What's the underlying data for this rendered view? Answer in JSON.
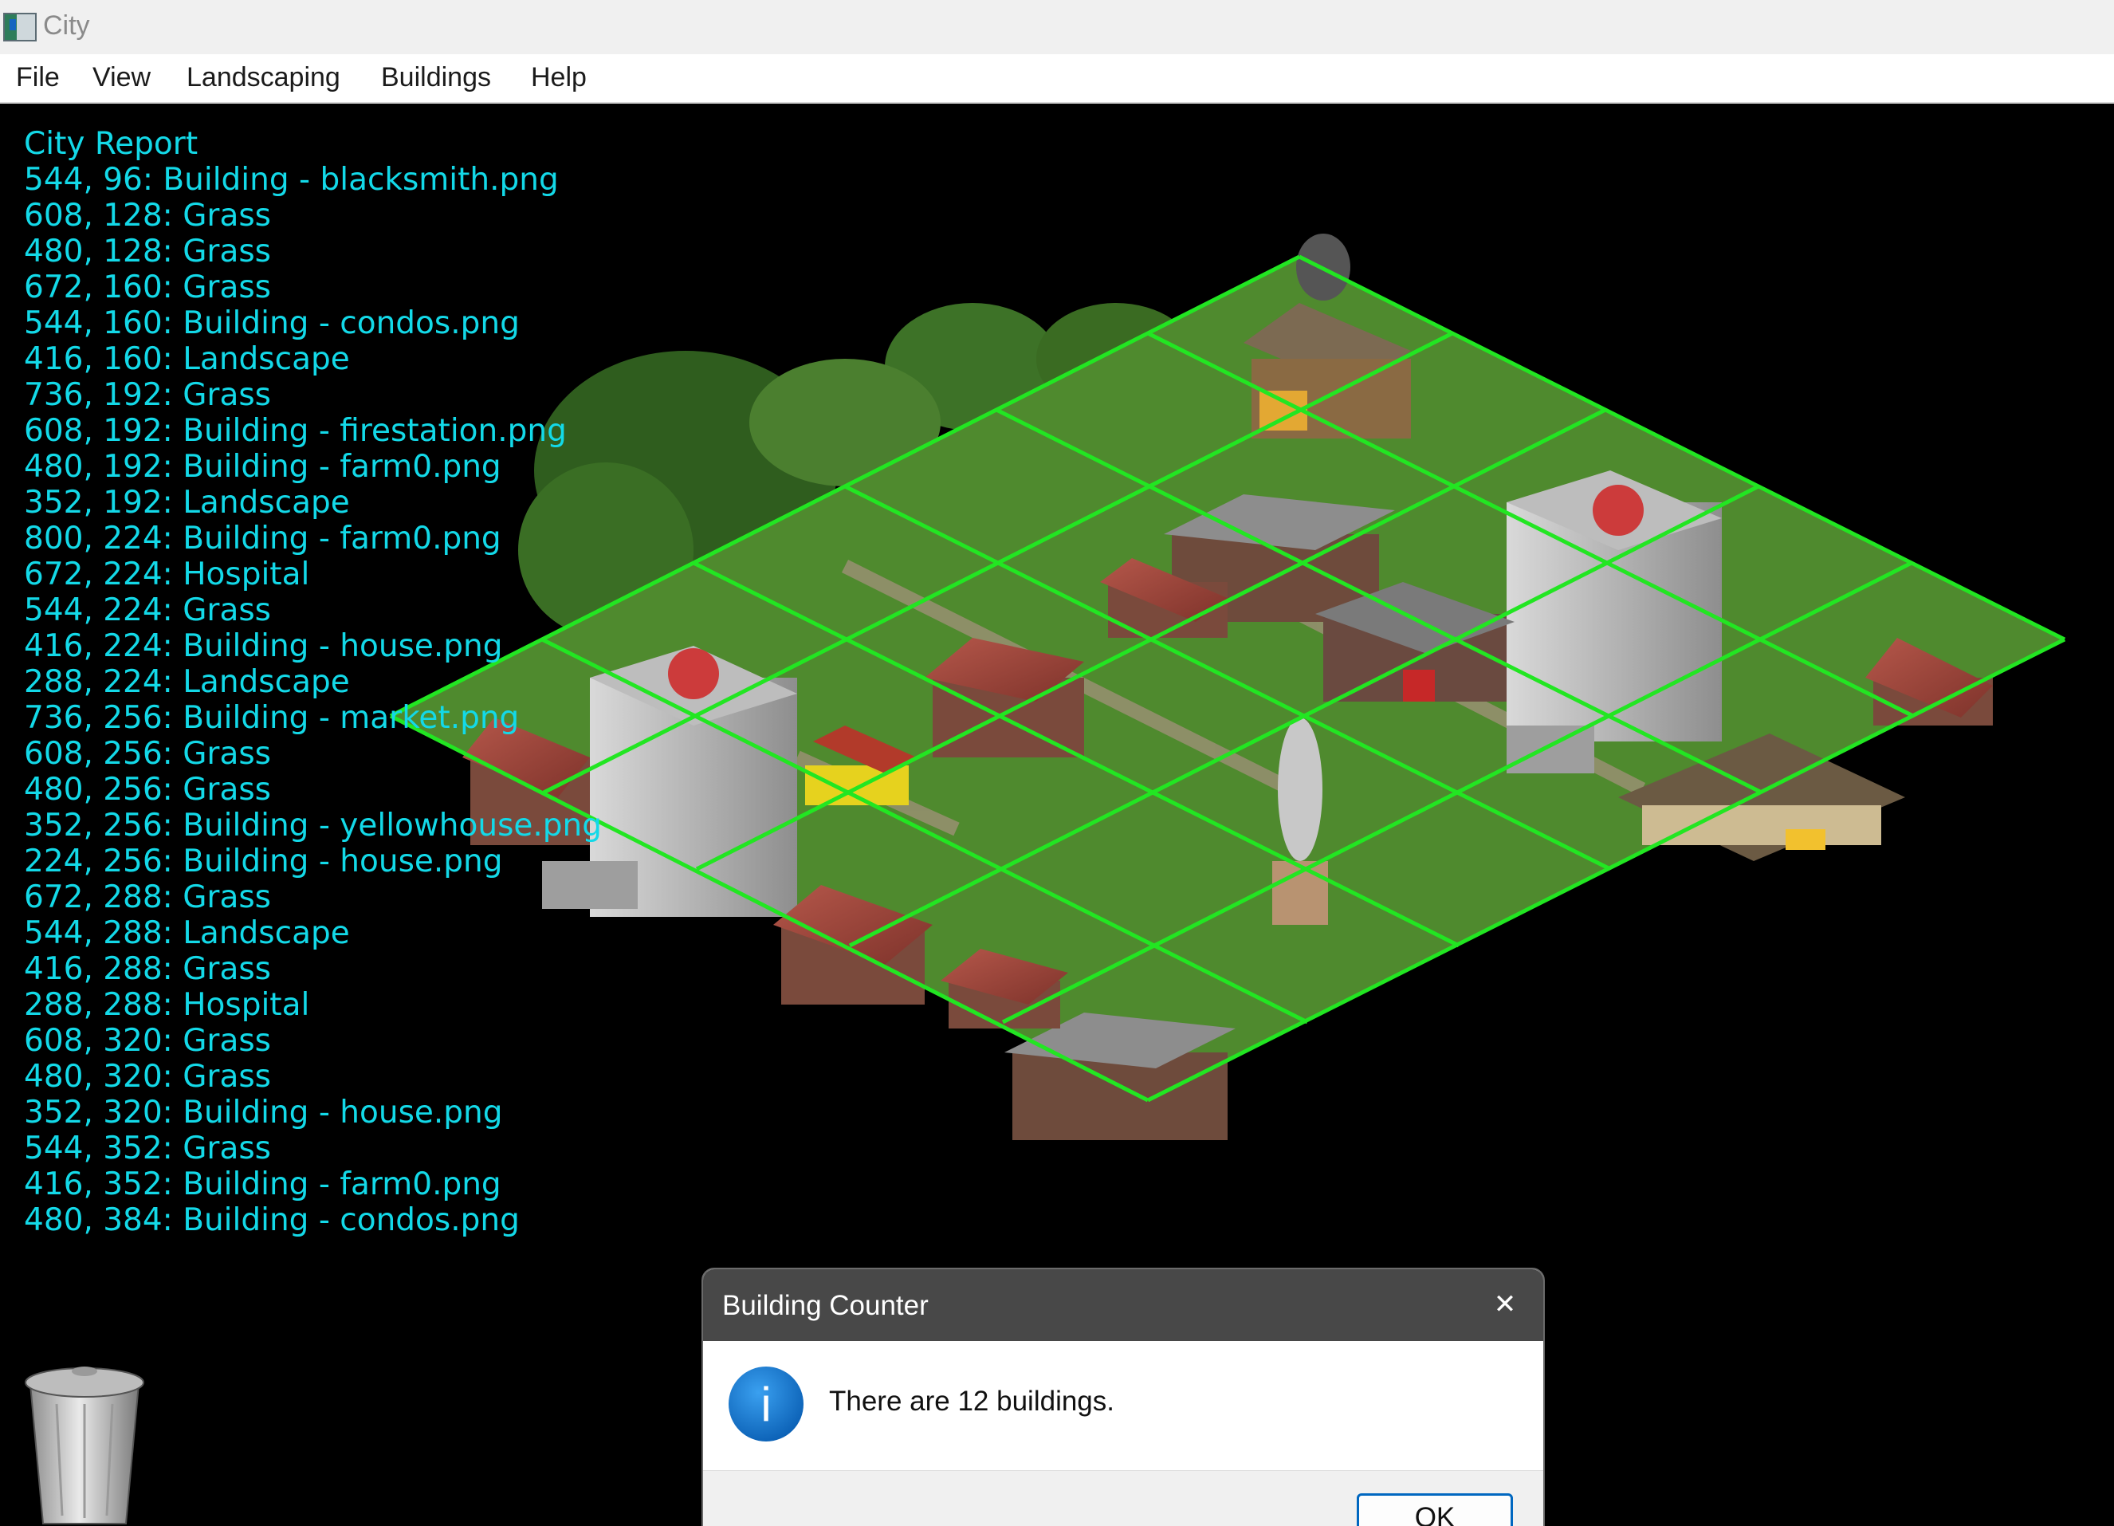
{
  "window": {
    "title": "City"
  },
  "menu": [
    "File",
    "View",
    "Landscaping",
    "Buildings",
    "Help"
  ],
  "report": {
    "title": "City Report",
    "lines": [
      "544, 96: Building - blacksmith.png",
      "608, 128: Grass",
      "480, 128: Grass",
      "672, 160: Grass",
      "544, 160: Building - condos.png",
      "416, 160: Landscape",
      "736, 192: Grass",
      "608, 192: Building - firestation.png",
      "480, 192: Building - farm0.png",
      "352, 192: Landscape",
      "800, 224: Building - farm0.png",
      "672, 224: Hospital",
      "544, 224: Grass",
      "416, 224: Building - house.png",
      "288, 224: Landscape",
      "736, 256: Building - market.png",
      "608, 256: Grass",
      "480, 256: Grass",
      "352, 256: Building - yellowhouse.png",
      "224, 256: Building - house.png",
      "672, 288: Grass",
      "544, 288: Landscape",
      "416, 288: Grass",
      "288, 288: Hospital",
      "608, 320: Grass",
      "480, 320: Grass",
      "352, 320: Building - house.png",
      "544, 352: Grass",
      "416, 352: Building - farm0.png",
      "480, 384: Building - condos.png"
    ]
  },
  "map": {
    "grid_color": "#22e622",
    "grass_color": "#4f8a2e"
  },
  "dialog": {
    "title": "Building Counter",
    "message": "There are 12 buildings.",
    "ok_label": "OK",
    "close_glyph": "✕",
    "icon": "info-icon",
    "icon_glyph": "i"
  },
  "icons": {
    "trash": "trash-can-icon",
    "app": "app-icon"
  }
}
